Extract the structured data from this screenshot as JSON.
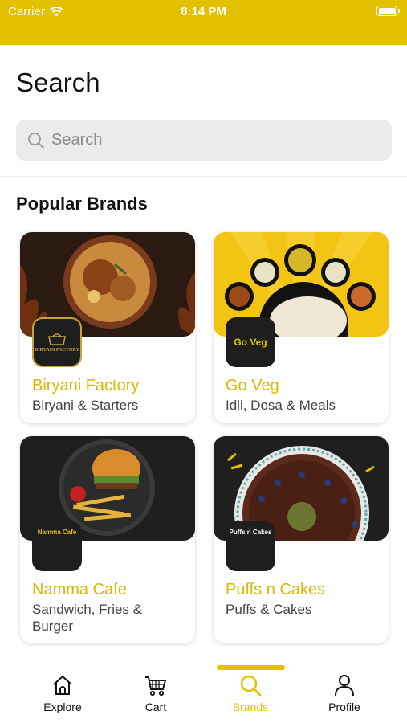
{
  "status_bar": {
    "carrier": "Carrier",
    "time": "8:14 PM",
    "color": "#E3C100"
  },
  "page": {
    "title": "Search"
  },
  "search": {
    "placeholder": "Search",
    "value": ""
  },
  "popular": {
    "heading": "Popular Brands",
    "brands": [
      {
        "name": "Biryani Factory",
        "description": "Biryani & Starters",
        "logo_text": "BIRYANI FACTORY",
        "banner": "biryani-plate-image"
      },
      {
        "name": "Go Veg",
        "description": "Idli, Dosa & Meals",
        "logo_text": "Go Veg",
        "banner": "south-indian-meals-image"
      },
      {
        "name": "Namma Cafe",
        "description": "Sandwich, Fries & Burger",
        "logo_text": "Namma Cafe",
        "banner": "burger-fries-image"
      },
      {
        "name": "Puffs n Cakes",
        "description": "Puffs & Cakes",
        "logo_text": "Puffs n Cakes",
        "banner": "chocolate-cake-image"
      }
    ]
  },
  "tabs": [
    {
      "label": "Explore",
      "icon": "home-icon",
      "active": false
    },
    {
      "label": "Cart",
      "icon": "cart-icon",
      "active": false
    },
    {
      "label": "Brands",
      "icon": "search-icon",
      "active": true
    },
    {
      "label": "Profile",
      "icon": "user-icon",
      "active": false
    }
  ],
  "colors": {
    "accent": "#E3C100",
    "brand_name": "#D9B800",
    "logo_bg": "#1e1e1e"
  }
}
